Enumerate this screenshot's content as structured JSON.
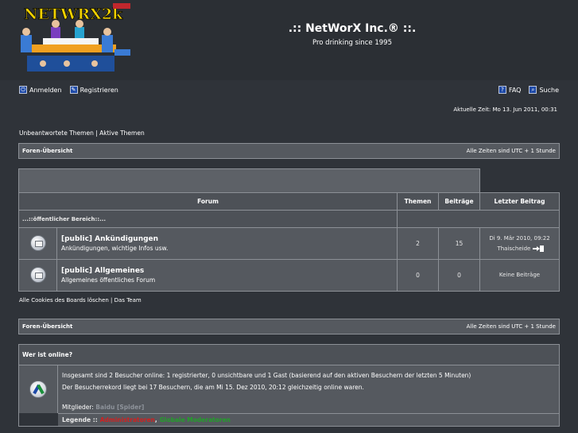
{
  "header": {
    "logo_text": "NETWRX2k",
    "title": ".:: NetWorX Inc.® ::.",
    "description": "Pro drinking since 1995"
  },
  "toplinks": {
    "login": "Anmelden",
    "register": "Registrieren",
    "faq": "FAQ",
    "search": "Suche"
  },
  "current_time": "Aktuelle Zeit: Mo 13. Jun 2011, 00:31",
  "quicklinks": {
    "unanswered": "Unbeantwortete Themen",
    "sep": "|",
    "active": "Aktive Themen"
  },
  "navbar": {
    "index": "Foren-Übersicht",
    "timezone": "Alle Zeiten sind UTC + 1 Stunde"
  },
  "forum_table": {
    "columns": [
      "Forum",
      "Themen",
      "Beiträge",
      "Letzter Beitrag"
    ],
    "section": "...::öffentlicher Bereich::...",
    "rows": [
      {
        "title": "[public] Ankündigungen",
        "description": "Ankündigungen, wichtige Infos usw.",
        "topics": "2",
        "posts": "15",
        "last_date": "Di 9. Mär 2010, 09:22",
        "last_user": "Thaischeide"
      },
      {
        "title": "[public] Allgemeines",
        "description": "Allgemeines öffentliches Forum",
        "topics": "0",
        "posts": "0",
        "last_date": "Keine Beiträge",
        "last_user": ""
      }
    ]
  },
  "footer_links": {
    "delete_cookies": "Alle Cookies des Boards löschen",
    "sep": "|",
    "team": "Das Team"
  },
  "online": {
    "title": "Wer ist online?",
    "line1": "Insgesamt sind 2 Besucher online: 1 registrierter, 0 unsichtbare und 1 Gast (basierend auf den aktiven Besuchern der letzten 5 Minuten)",
    "line2": "Der Besucherrekord liegt bei 17 Besuchern, die am Mi 15. Dez 2010, 20:12 gleichzeitig online waren.",
    "members_label": "Mitglieder:",
    "members_value": "Baidu [Spider]",
    "legend_label": "Legende ::",
    "legend_admins": "Administratoren",
    "legend_mods": "Globale Moderatoren"
  },
  "colors": {
    "background": "#2f3339",
    "panel": "#55595f",
    "admin": "#d12020",
    "mod": "#22a02a"
  }
}
